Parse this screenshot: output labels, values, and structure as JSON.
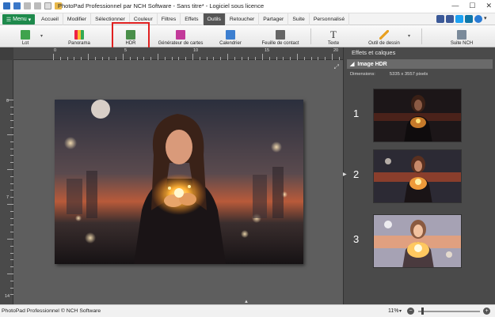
{
  "window": {
    "title": "PhotoPad Professionnel par NCH Software - Sans titre* - Logiciel sous licence",
    "controls": [
      "—",
      "☐",
      "✕"
    ]
  },
  "menubar": {
    "menu_label": "Menu",
    "tabs": [
      "Accueil",
      "Modifier",
      "Sélectionner",
      "Couleur",
      "Filtres",
      "Effets",
      "Outils",
      "Retoucher",
      "Partager",
      "Suite",
      "Personnalisé"
    ],
    "active_tab": "Outils"
  },
  "toolbar": {
    "items": [
      {
        "label": "Lot",
        "icon": "batch-icon"
      },
      {
        "label": "Panorama",
        "icon": "panorama-icon"
      },
      {
        "label": "HDR",
        "icon": "hdr-icon"
      },
      {
        "label": "Générateur de cartes",
        "icon": "card-generator-icon"
      },
      {
        "label": "Calendrier",
        "icon": "calendar-icon"
      },
      {
        "label": "Feuille de contact",
        "icon": "contact-sheet-icon"
      },
      {
        "label": "Texte",
        "icon": "text-icon"
      },
      {
        "label": "Outil de dessin",
        "icon": "draw-icon"
      },
      {
        "label": "Suite NCH",
        "icon": "nch-suite-icon"
      }
    ]
  },
  "ruler": {
    "top_numbers": [
      "0",
      "5",
      "10",
      "15",
      "20"
    ],
    "left_numbers": [
      "0",
      "7",
      "14"
    ]
  },
  "panel": {
    "title": "Effets et calques",
    "group_label": "Image HDR",
    "dimensions_label": "Dimensions:",
    "dimensions_value": "5335 x 3557 pixels",
    "hdr_items": [
      {
        "number": "1"
      },
      {
        "number": "2"
      },
      {
        "number": "3"
      }
    ]
  },
  "status": {
    "text": "PhotoPad Professionnel © NCH Software",
    "zoom": "11%",
    "zoom_level": 0.05
  }
}
